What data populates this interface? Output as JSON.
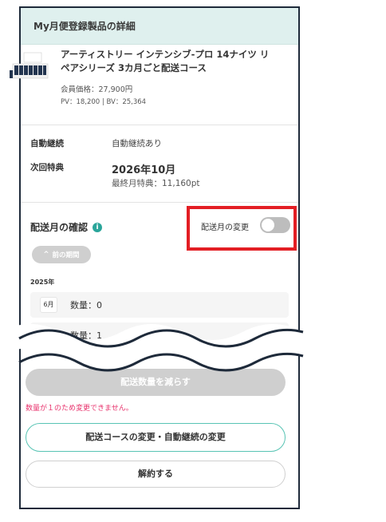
{
  "header": {
    "title": "My月便登録製品の詳細"
  },
  "product": {
    "name": "アーティストリー インテンシブ-プロ 14ナイツ リペアシリーズ 3カ月ごと配送コース",
    "price": "会員価格：27,900円",
    "pv_bv": "PV：18,200 | BV：25,364",
    "thumb_icon": "product-box-icon"
  },
  "details": {
    "auto_label": "自動継続",
    "auto_value": "自動継続あり",
    "next_label": "次回特典",
    "next_year": "2026年",
    "next_month": "10月",
    "next_points": "最終月特典：11,160pt"
  },
  "delivery": {
    "title": "配送月の確認",
    "info_icon": "info-icon",
    "toggle_label": "配送月の変更",
    "toggle_on": false,
    "prev_button": "前の期間",
    "year": "2025年",
    "months": [
      {
        "month": "6月",
        "qty": "数量：0"
      },
      {
        "month": "",
        "qty": "数量：1"
      }
    ]
  },
  "actions": {
    "reduce_label": "配送数量を減らす",
    "warning": "数量が１のため変更できません。",
    "course_change_label": "配送コースの変更・自動継続の変更",
    "cancel_label": "解約する"
  },
  "colors": {
    "accent": "#2aa59a",
    "highlight": "#e31e24",
    "warning": "#e8336d",
    "header_bg": "#dff0ee"
  }
}
